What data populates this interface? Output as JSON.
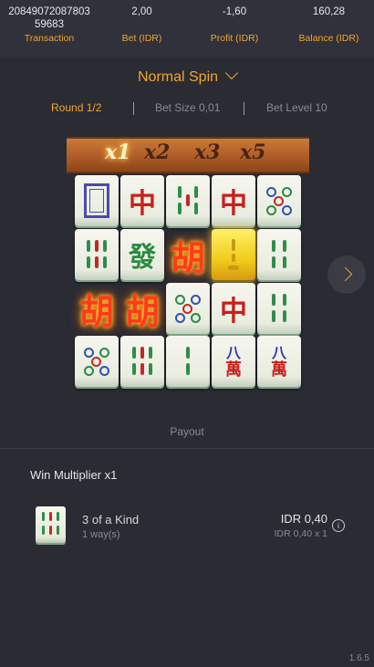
{
  "header": {
    "transaction_value": "20849072087803\n59683",
    "transaction_line1": "20849072087803",
    "transaction_line2": "59683",
    "transaction_label": "Transaction",
    "bet_value": "2,00",
    "bet_label": "Bet (IDR)",
    "profit_value": "-1,60",
    "profit_label": "Profit (IDR)",
    "balance_value": "160,28",
    "balance_label": "Balance (IDR)"
  },
  "spin_type": "Normal Spin",
  "round_info": {
    "round": "Round 1/2",
    "bet_size": "Bet Size 0,01",
    "bet_level": "Bet Level 10"
  },
  "multipliers": [
    "x1",
    "x2",
    "x3",
    "x5"
  ],
  "active_multiplier": "x1",
  "tiles": {
    "zhong": "中",
    "fa": "發",
    "hu": "胡",
    "ba": "八",
    "wan": "萬"
  },
  "payout": {
    "title": "Payout",
    "win_multiplier": "Win Multiplier x1",
    "combo_name": "3 of a Kind",
    "ways": "1 way(s)",
    "amount": "IDR 0,40",
    "amount_detail": "IDR 0,40 x 1"
  },
  "version": "1.6.5",
  "colors": {
    "accent": "#f0a532",
    "background": "#2a2b33"
  }
}
